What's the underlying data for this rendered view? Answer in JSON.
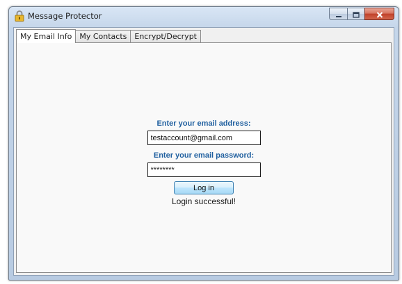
{
  "window": {
    "title": "Message Protector"
  },
  "tabs": [
    {
      "label": "My Email Info",
      "active": true
    },
    {
      "label": "My Contacts",
      "active": false
    },
    {
      "label": "Encrypt/Decrypt",
      "active": false
    }
  ],
  "form": {
    "email_label": "Enter your email address:",
    "email_value": "testaccount@gmail.com",
    "password_label": "Enter your email password:",
    "password_value": "********",
    "login_button": "Log in",
    "status": "Login successful!"
  },
  "colors": {
    "label_blue": "#1f5f9f",
    "close_red": "#c0412a"
  },
  "icons": {
    "app": "lock-icon",
    "minimize": "minimize-icon",
    "maximize": "maximize-icon",
    "close": "close-icon"
  }
}
